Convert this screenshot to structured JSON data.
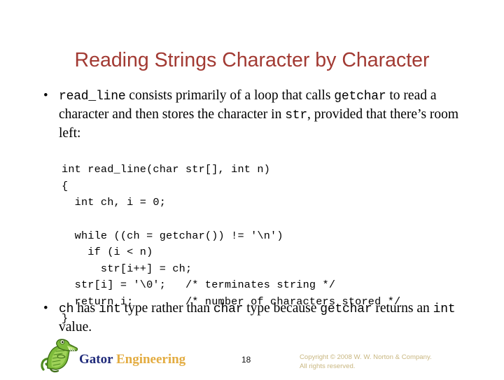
{
  "slide": {
    "title": "Reading Strings Character by Character",
    "title_color": "#A23A33",
    "background_color": "#FFFFFF",
    "bullet_glyph": "•"
  },
  "bullets": [
    {
      "id": "bullet-read-line",
      "parts": [
        {
          "type": "code",
          "text": "read_line"
        },
        {
          "type": "text",
          "text": " consists primarily of a loop that calls "
        },
        {
          "type": "code",
          "text": "getchar"
        },
        {
          "type": "text",
          "text": " to read a character and then stores the character in "
        },
        {
          "type": "code",
          "text": "str"
        },
        {
          "type": "text",
          "text": ", provided that there’s room left:"
        }
      ]
    },
    {
      "id": "bullet-ch-type",
      "parts": [
        {
          "type": "code",
          "text": "ch"
        },
        {
          "type": "text",
          "text": " has "
        },
        {
          "type": "code",
          "text": "int"
        },
        {
          "type": "text",
          "text": " type rather than "
        },
        {
          "type": "code",
          "text": "char"
        },
        {
          "type": "text",
          "text": " type because "
        },
        {
          "type": "code",
          "text": "getchar"
        },
        {
          "type": "text",
          "text": " returns an "
        },
        {
          "type": "code",
          "text": "int"
        },
        {
          "type": "text",
          "text": " value."
        }
      ]
    }
  ],
  "code": {
    "language": "c",
    "lines": [
      "int read_line(char str[], int n)",
      "{",
      "  int ch, i = 0;",
      "",
      "  while ((ch = getchar()) != '\\n')",
      "    if (i < n)",
      "      str[i++] = ch;",
      "  str[i] = '\\0';   /* terminates string */",
      "  return i;        /* number of characters stored */",
      "}"
    ]
  },
  "footer": {
    "logo_icon": "gator-mascot-icon",
    "brand_first": "Gator",
    "brand_second": "Engineering",
    "brand_first_color": "#1F2A7A",
    "brand_second_color": "#E3AC41",
    "page_number": "18",
    "copyright_line_1": "Copyright © 2008 W. W. Norton & Company.",
    "copyright_line_2": "All rights reserved.",
    "copyright_color": "#C9B781"
  }
}
